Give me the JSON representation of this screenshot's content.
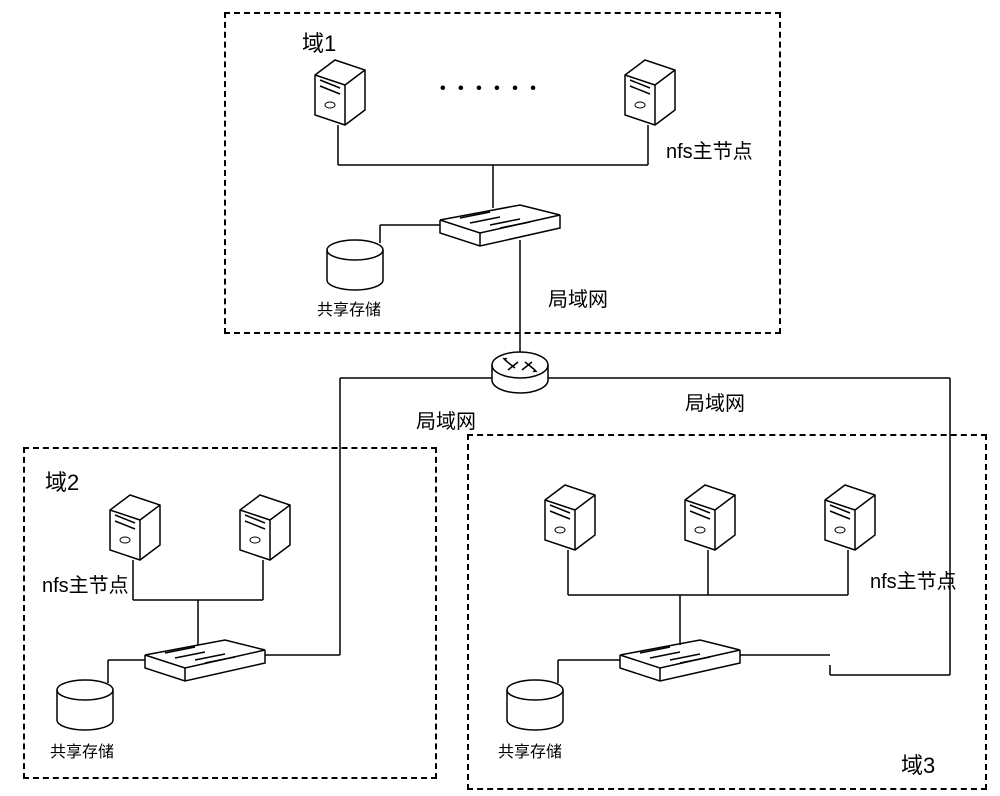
{
  "domains": {
    "domain1": {
      "label": "域1"
    },
    "domain2": {
      "label": "域2"
    },
    "domain3": {
      "label": "域3"
    }
  },
  "nodes": {
    "nfs_master": "nfs主节点",
    "shared_storage": "共享存储",
    "lan": "局域网"
  },
  "dots": "• • • • • •"
}
